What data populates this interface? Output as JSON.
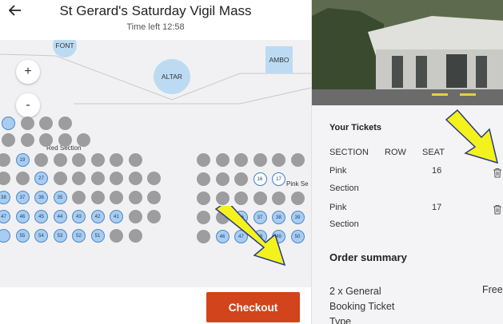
{
  "header": {
    "title": "St Gerard's Saturday Vigil Mass",
    "time_left": "Time left 12:58"
  },
  "map": {
    "labels": {
      "font": "FONT",
      "altar": "ALTAR",
      "ambo": "AMBO",
      "red_section": "Red Section",
      "pink_section": "Pink Se"
    },
    "zoom_in": "+",
    "zoom_out": "-",
    "red_seats": [
      {
        "row": 0,
        "label": "",
        "state": "avail"
      },
      {
        "row": 0,
        "label": "",
        "state": "unavail"
      },
      {
        "row": 0,
        "label": "",
        "state": "unavail"
      },
      {
        "row": 0,
        "label": "",
        "state": "unavail"
      },
      {
        "row": 1,
        "label": "",
        "state": "unavail"
      },
      {
        "row": 1,
        "label": "",
        "state": "unavail"
      },
      {
        "row": 1,
        "label": "",
        "state": "unavail"
      },
      {
        "row": 1,
        "label": "",
        "state": "unavail"
      },
      {
        "row": 1,
        "label": "",
        "state": "unavail"
      },
      {
        "row": 2,
        "label": "",
        "state": "unavail"
      },
      {
        "row": 2,
        "label": "19",
        "state": "avail"
      },
      {
        "row": 2,
        "label": "",
        "state": "unavail"
      },
      {
        "row": 2,
        "label": "",
        "state": "unavail"
      },
      {
        "row": 2,
        "label": "",
        "state": "unavail"
      },
      {
        "row": 2,
        "label": "",
        "state": "unavail"
      },
      {
        "row": 2,
        "label": "",
        "state": "unavail"
      },
      {
        "row": 2,
        "label": "",
        "state": "unavail"
      },
      {
        "row": 3,
        "label": "",
        "state": "unavail"
      },
      {
        "row": 3,
        "label": "",
        "state": "unavail"
      },
      {
        "row": 3,
        "label": "27",
        "state": "avail"
      },
      {
        "row": 3,
        "label": "",
        "state": "unavail"
      },
      {
        "row": 3,
        "label": "",
        "state": "unavail"
      },
      {
        "row": 3,
        "label": "",
        "state": "unavail"
      },
      {
        "row": 3,
        "label": "",
        "state": "unavail"
      },
      {
        "row": 3,
        "label": "",
        "state": "unavail"
      },
      {
        "row": 3,
        "label": "",
        "state": "unavail"
      },
      {
        "row": 4,
        "label": "38",
        "state": "avail"
      },
      {
        "row": 4,
        "label": "37",
        "state": "avail"
      },
      {
        "row": 4,
        "label": "36",
        "state": "avail"
      },
      {
        "row": 4,
        "label": "35",
        "state": "avail"
      },
      {
        "row": 4,
        "label": "",
        "state": "unavail"
      },
      {
        "row": 4,
        "label": "",
        "state": "unavail"
      },
      {
        "row": 4,
        "label": "",
        "state": "unavail"
      },
      {
        "row": 4,
        "label": "",
        "state": "unavail"
      },
      {
        "row": 4,
        "label": "",
        "state": "unavail"
      },
      {
        "row": 5,
        "label": "47",
        "state": "avail"
      },
      {
        "row": 5,
        "label": "46",
        "state": "avail"
      },
      {
        "row": 5,
        "label": "45",
        "state": "avail"
      },
      {
        "row": 5,
        "label": "44",
        "state": "avail"
      },
      {
        "row": 5,
        "label": "43",
        "state": "avail"
      },
      {
        "row": 5,
        "label": "42",
        "state": "avail"
      },
      {
        "row": 5,
        "label": "41",
        "state": "avail"
      },
      {
        "row": 5,
        "label": "",
        "state": "unavail"
      },
      {
        "row": 5,
        "label": "",
        "state": "unavail"
      },
      {
        "row": 6,
        "label": "",
        "state": "avail"
      },
      {
        "row": 6,
        "label": "55",
        "state": "avail"
      },
      {
        "row": 6,
        "label": "54",
        "state": "avail"
      },
      {
        "row": 6,
        "label": "53",
        "state": "avail"
      },
      {
        "row": 6,
        "label": "52",
        "state": "avail"
      },
      {
        "row": 6,
        "label": "51",
        "state": "avail"
      },
      {
        "row": 6,
        "label": "",
        "state": "unavail"
      },
      {
        "row": 6,
        "label": "",
        "state": "unavail"
      }
    ],
    "pink_seats": [
      {
        "row": 3,
        "label": "",
        "state": "unavail"
      },
      {
        "row": 3,
        "label": "",
        "state": "unavail"
      },
      {
        "row": 3,
        "label": "",
        "state": "unavail"
      },
      {
        "row": 3,
        "label": "",
        "state": "unavail"
      },
      {
        "row": 3,
        "label": "",
        "state": "unavail"
      },
      {
        "row": 3,
        "label": "",
        "state": "unavail"
      },
      {
        "row": 4,
        "label": "",
        "state": "unavail"
      },
      {
        "row": 4,
        "label": "",
        "state": "unavail"
      },
      {
        "row": 4,
        "label": "",
        "state": "unavail"
      },
      {
        "row": 4,
        "label": "16",
        "state": "sel"
      },
      {
        "row": 4,
        "label": "17",
        "state": "sel"
      },
      {
        "row": 5,
        "label": "",
        "state": "unavail"
      },
      {
        "row": 5,
        "label": "",
        "state": "unavail"
      },
      {
        "row": 5,
        "label": "",
        "state": "unavail"
      },
      {
        "row": 5,
        "label": "",
        "state": "unavail"
      },
      {
        "row": 5,
        "label": "",
        "state": "unavail"
      },
      {
        "row": 5,
        "label": "",
        "state": "unavail"
      },
      {
        "row": 6,
        "label": "",
        "state": "unavail"
      },
      {
        "row": 6,
        "label": "",
        "state": "unavail"
      },
      {
        "row": 6,
        "label": "36",
        "state": "avail"
      },
      {
        "row": 6,
        "label": "37",
        "state": "avail"
      },
      {
        "row": 6,
        "label": "38",
        "state": "avail"
      },
      {
        "row": 6,
        "label": "39",
        "state": "avail"
      },
      {
        "row": 7,
        "label": "",
        "state": "unavail"
      },
      {
        "row": 7,
        "label": "46",
        "state": "avail"
      },
      {
        "row": 7,
        "label": "47",
        "state": "avail"
      },
      {
        "row": 7,
        "label": "48",
        "state": "avail"
      },
      {
        "row": 7,
        "label": "49",
        "state": "avail"
      },
      {
        "row": 7,
        "label": "50",
        "state": "avail"
      }
    ],
    "colors": {
      "unavailable": "#9d9d9f",
      "available": "#a9cdf0",
      "selected_border": "#3b7fd0"
    }
  },
  "checkout": {
    "label": "Checkout",
    "color": "#d2441c"
  },
  "tickets": {
    "heading": "Your Tickets",
    "columns": [
      "SECTION",
      "ROW",
      "SEAT"
    ],
    "rows": [
      {
        "section_line1": "Pink",
        "section_line2": "Section",
        "row": "",
        "seat": "16"
      },
      {
        "section_line1": "Pink",
        "section_line2": "Section",
        "row": "",
        "seat": "17"
      }
    ]
  },
  "summary": {
    "heading": "Order summary",
    "ticket_line1": "2 x General",
    "ticket_line2": "Booking Ticket",
    "ticket_line3": "Type",
    "price": "Free"
  },
  "annotation": {
    "arrow_color": "#f4f21c"
  }
}
